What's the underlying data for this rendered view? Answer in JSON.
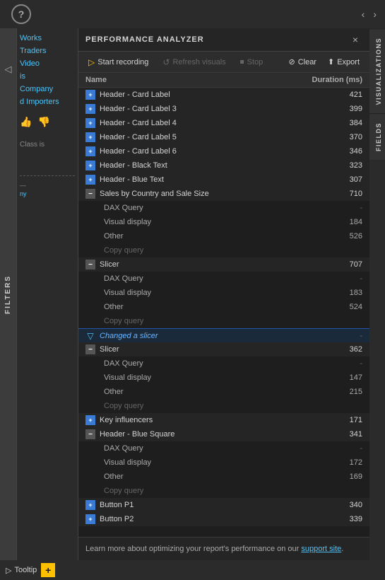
{
  "header": {
    "title": "PERFORMANCE ANALYZER",
    "close_label": "×",
    "nav_back": "‹",
    "nav_fwd": "›"
  },
  "toolbar": {
    "start_recording_label": "Start recording",
    "refresh_visuals_label": "Refresh visuals",
    "stop_label": "Stop",
    "clear_label": "Clear",
    "export_label": "Export",
    "start_icon": "▷",
    "refresh_icon": "↺",
    "stop_icon": "⏹",
    "clear_icon": "⊘",
    "export_icon": "⬆"
  },
  "list_header": {
    "name_col": "Name",
    "duration_col": "Duration (ms)"
  },
  "items": [
    {
      "id": 1,
      "type": "top",
      "icon": "plus",
      "name": "Header - Card Label",
      "duration": "421"
    },
    {
      "id": 2,
      "type": "top",
      "icon": "plus",
      "name": "Header - Card Label 3",
      "duration": "399"
    },
    {
      "id": 3,
      "type": "top",
      "icon": "plus",
      "name": "Header - Card Label 4",
      "duration": "384"
    },
    {
      "id": 4,
      "type": "top",
      "icon": "plus",
      "name": "Header - Card Label 5",
      "duration": "370"
    },
    {
      "id": 5,
      "type": "top",
      "icon": "plus",
      "name": "Header - Card Label 6",
      "duration": "346"
    },
    {
      "id": 6,
      "type": "top",
      "icon": "plus",
      "name": "Header - Black Text",
      "duration": "323"
    },
    {
      "id": 7,
      "type": "top",
      "icon": "plus",
      "name": "Header - Blue Text",
      "duration": "307"
    },
    {
      "id": 8,
      "type": "expanded",
      "icon": "minus",
      "name": "Sales by Country and Sale Size",
      "duration": "710"
    },
    {
      "id": 9,
      "type": "child",
      "name": "DAX Query",
      "duration": "-"
    },
    {
      "id": 10,
      "type": "child",
      "name": "Visual display",
      "duration": "184"
    },
    {
      "id": 11,
      "type": "child",
      "name": "Other",
      "duration": "526"
    },
    {
      "id": 12,
      "type": "child-action",
      "name": "Copy query",
      "duration": ""
    },
    {
      "id": 13,
      "type": "expanded",
      "icon": "minus",
      "name": "Slicer",
      "duration": "707"
    },
    {
      "id": 14,
      "type": "child",
      "name": "DAX Query",
      "duration": "-"
    },
    {
      "id": 15,
      "type": "child",
      "name": "Visual display",
      "duration": "183"
    },
    {
      "id": 16,
      "type": "child",
      "name": "Other",
      "duration": "524"
    },
    {
      "id": 17,
      "type": "child-action",
      "name": "Copy query",
      "duration": ""
    },
    {
      "id": 18,
      "type": "changed-slicer",
      "icon": "filter",
      "name": "Changed a slicer",
      "duration": "-"
    },
    {
      "id": 19,
      "type": "expanded",
      "icon": "minus",
      "name": "Slicer",
      "duration": "362"
    },
    {
      "id": 20,
      "type": "child",
      "name": "DAX Query",
      "duration": "-"
    },
    {
      "id": 21,
      "type": "child",
      "name": "Visual display",
      "duration": "147"
    },
    {
      "id": 22,
      "type": "child",
      "name": "Other",
      "duration": "215"
    },
    {
      "id": 23,
      "type": "child-action",
      "name": "Copy query",
      "duration": ""
    },
    {
      "id": 24,
      "type": "top",
      "icon": "plus",
      "name": "Key influencers",
      "duration": "171"
    },
    {
      "id": 25,
      "type": "expanded",
      "icon": "minus",
      "name": "Header - Blue Square",
      "duration": "341"
    },
    {
      "id": 26,
      "type": "child",
      "name": "DAX Query",
      "duration": "-"
    },
    {
      "id": 27,
      "type": "child",
      "name": "Visual display",
      "duration": "172"
    },
    {
      "id": 28,
      "type": "child",
      "name": "Other",
      "duration": "169"
    },
    {
      "id": 29,
      "type": "child-action",
      "name": "Copy query",
      "duration": ""
    },
    {
      "id": 30,
      "type": "top",
      "icon": "plus",
      "name": "Button P1",
      "duration": "340"
    },
    {
      "id": 31,
      "type": "top",
      "icon": "plus",
      "name": "Button P2",
      "duration": "339"
    }
  ],
  "bottom_bar": {
    "text": "Learn more about optimizing your report's performance on our ",
    "link_text": "support site",
    "link_url": "#"
  },
  "right_tabs": [
    {
      "id": "visualizations",
      "label": "VISUALIZATIONS"
    },
    {
      "id": "fields",
      "label": "FIELDS"
    }
  ],
  "left_sidebar": {
    "filters_label": "FILTERS",
    "links": [
      {
        "label": "Works"
      },
      {
        "label": "Traders"
      },
      {
        "label": "Video"
      },
      {
        "label": "is"
      },
      {
        "label": "Company"
      },
      {
        "label": "d Importers"
      }
    ],
    "class_is": "Class is",
    "hint": "—",
    "hint2": "ny"
  },
  "tooltip_bar": {
    "tooltip_label": "Tooltip",
    "add_label": "+"
  }
}
